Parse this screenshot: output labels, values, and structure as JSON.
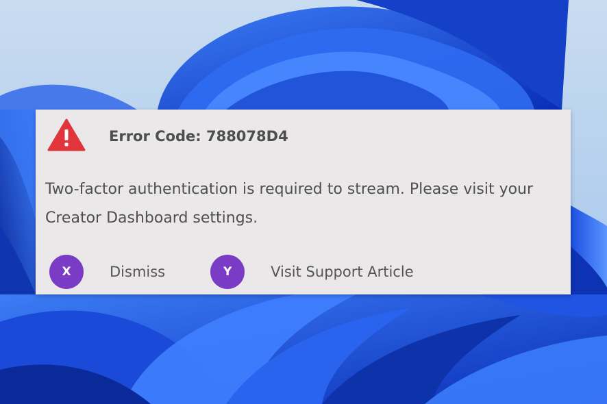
{
  "dialog": {
    "title": "Error Code: 788078D4",
    "message": "Two-factor authentication is required to stream. Please visit your Creator Dashboard settings.",
    "icon": "warning-triangle-icon",
    "actions": [
      {
        "button_glyph": "X",
        "label": "Dismiss"
      },
      {
        "button_glyph": "Y",
        "label": "Visit Support Article"
      }
    ]
  },
  "colors": {
    "dialog_background": "#ebe8e9",
    "warning_red": "#e0353a",
    "button_purple": "#7a3cc4",
    "text_gray": "#4f4f4f",
    "wallpaper_blue": "#1f56e0"
  },
  "wallpaper": "windows-11-bloom-wallpaper"
}
